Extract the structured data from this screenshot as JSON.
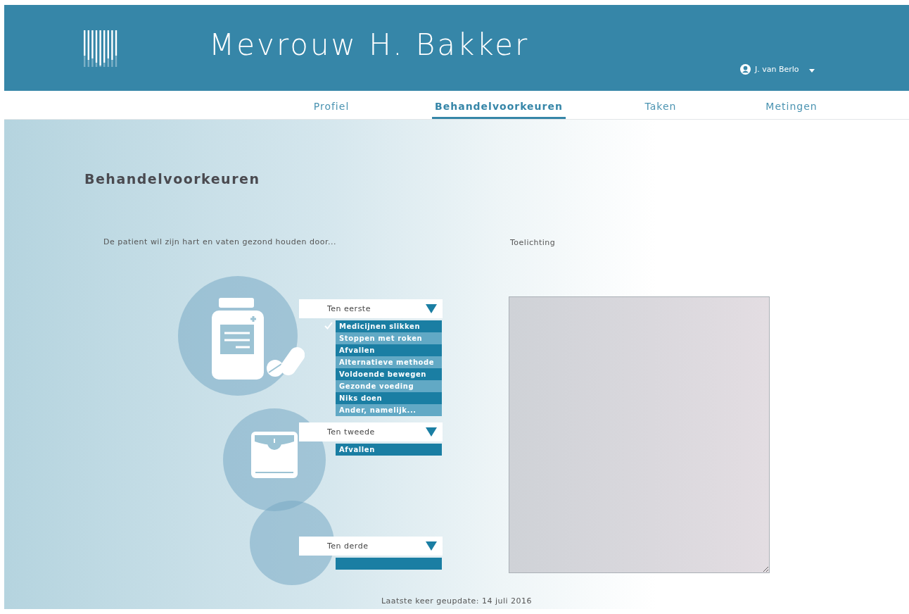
{
  "header": {
    "title": "Mevrouw H. Bakker",
    "user": {
      "name": "J. van Berlo"
    }
  },
  "tabs": [
    {
      "label": "Profiel",
      "selected": false
    },
    {
      "label": "Behandelvoorkeuren",
      "selected": true
    },
    {
      "label": "Taken",
      "selected": false
    },
    {
      "label": "Metingen",
      "selected": false
    }
  ],
  "page_title": "Behandelvoorkeuren",
  "prompt": "De patient wil zijn hart en vaten gezond houden door...",
  "priorities": [
    {
      "label": "Ten eerste",
      "blank_row": false,
      "options": [
        {
          "label": "Medicijnen slikken",
          "checked": true
        },
        {
          "label": "Stoppen met roken",
          "checked": false
        },
        {
          "label": "Afvallen",
          "checked": false
        },
        {
          "label": "Alternatieve methode",
          "checked": false
        },
        {
          "label": "Voldoende bewegen",
          "checked": false
        },
        {
          "label": "Gezonde voeding",
          "checked": false
        },
        {
          "label": "Niks doen",
          "checked": false
        },
        {
          "label": "Ander, namelijk...",
          "checked": false
        }
      ]
    },
    {
      "label": "Ten tweede",
      "blank_row": false,
      "options": [
        {
          "label": "Afvallen",
          "checked": false
        }
      ]
    },
    {
      "label": "Ten derde",
      "blank_row": true
    }
  ],
  "notes": {
    "label": "Toelichting"
  },
  "footer": "Laatste keer geupdate: 14 juli 2016"
}
